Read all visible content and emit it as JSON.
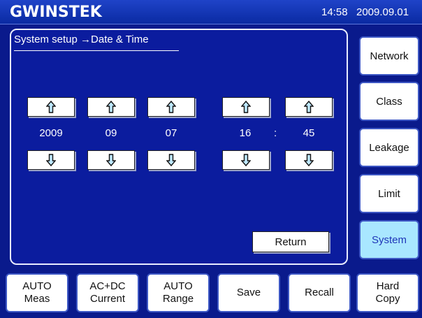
{
  "header": {
    "logo": "GWINSTEK",
    "time": "14:58",
    "date": "2009.09.01"
  },
  "panel": {
    "title": "System setup →Date & Time",
    "fields": [
      {
        "name": "year",
        "value": "2009"
      },
      {
        "name": "month",
        "value": "09"
      },
      {
        "name": "day",
        "value": "07"
      },
      {
        "name": "hour",
        "value": "16"
      },
      {
        "name": "minute",
        "value": "45"
      }
    ],
    "separator": ":",
    "return_label": "Return"
  },
  "sidebar": {
    "items": [
      {
        "label": "Network",
        "active": false
      },
      {
        "label": "Class",
        "active": false
      },
      {
        "label": "Leakage",
        "active": false
      },
      {
        "label": "Limit",
        "active": false
      },
      {
        "label": "System",
        "active": true
      }
    ]
  },
  "softkeys": [
    {
      "line1": "AUTO",
      "line2": "Meas"
    },
    {
      "line1": "AC+DC",
      "line2": "Current"
    },
    {
      "line1": "AUTO",
      "line2": "Range"
    },
    {
      "line1": "Save",
      "line2": ""
    },
    {
      "line1": "Recall",
      "line2": ""
    },
    {
      "line1": "Hard",
      "line2": "Copy"
    }
  ],
  "icons": {
    "up": "arrow-up-icon",
    "down": "arrow-down-icon"
  },
  "colors": {
    "background": "#0a1a8c",
    "active_button": "#a9e7ff",
    "button_border": "#3e58c5"
  }
}
